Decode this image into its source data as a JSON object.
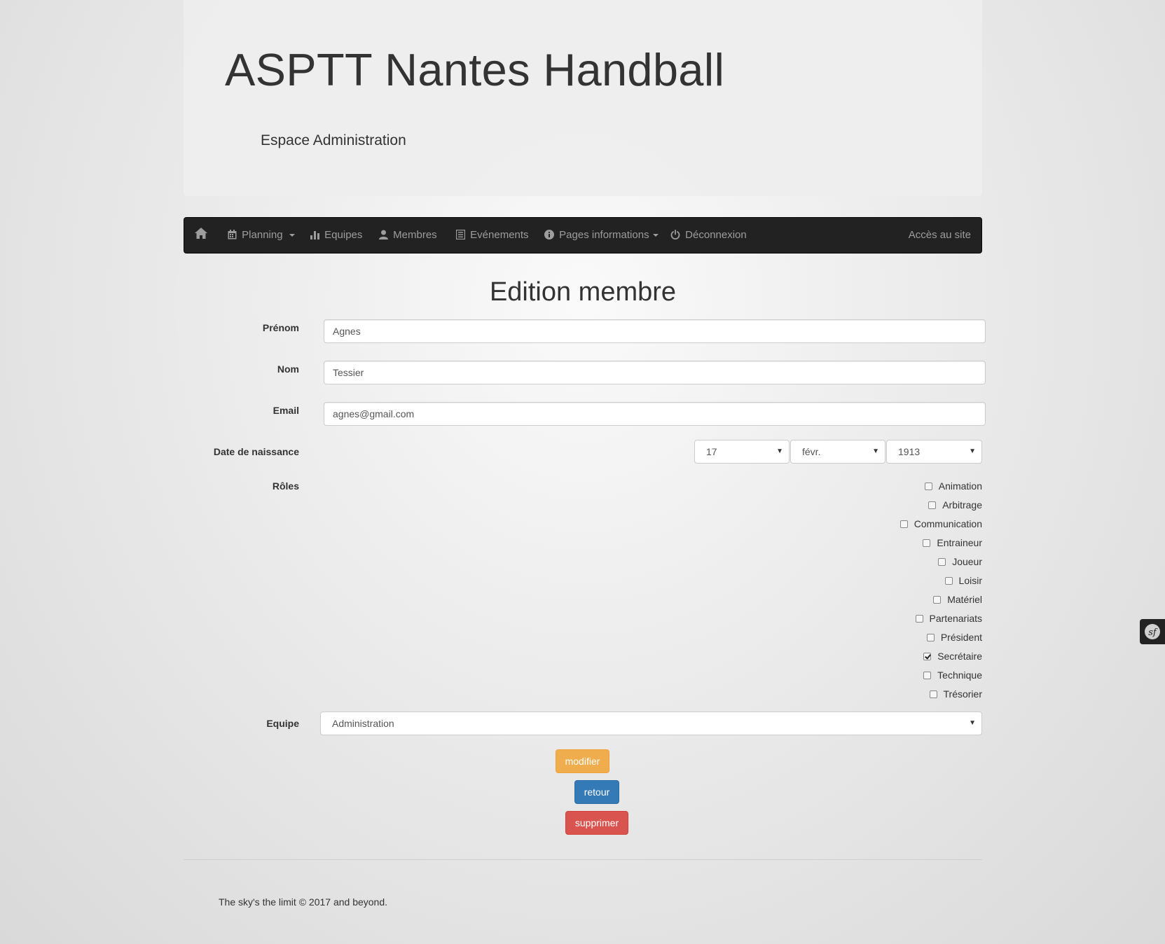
{
  "header": {
    "title": "ASPTT Nantes Handball",
    "subtitle": "Espace Administration"
  },
  "navbar": {
    "home_icon": "home-icon",
    "items": [
      {
        "label": "Planning",
        "icon": "calendar-icon",
        "dropdown": true
      },
      {
        "label": "Equipes",
        "icon": "stats-icon",
        "dropdown": false
      },
      {
        "label": "Membres",
        "icon": "user-icon",
        "dropdown": false
      },
      {
        "label": "Evénements",
        "icon": "list-icon",
        "dropdown": false
      },
      {
        "label": "Pages informations",
        "icon": "info-icon",
        "dropdown": true
      },
      {
        "label": "Déconnexion",
        "icon": "power-icon",
        "dropdown": false
      }
    ],
    "right_link": "Accès au site",
    "background": "#222222",
    "text_color": "#9d9d9d"
  },
  "page_title": "Edition membre",
  "form": {
    "prenom": {
      "label": "Prénom",
      "value": "Agnes"
    },
    "nom": {
      "label": "Nom",
      "value": "Tessier"
    },
    "email": {
      "label": "Email",
      "value": "agnes@gmail.com"
    },
    "birthdate": {
      "label": "Date de naissance",
      "day": "17",
      "month": "févr.",
      "year": "1913"
    },
    "roles": {
      "label": "Rôles",
      "items": [
        {
          "label": "Animation",
          "checked": false
        },
        {
          "label": "Arbitrage",
          "checked": false
        },
        {
          "label": "Communication",
          "checked": false
        },
        {
          "label": "Entraineur",
          "checked": false
        },
        {
          "label": "Joueur",
          "checked": false
        },
        {
          "label": "Loisir",
          "checked": false
        },
        {
          "label": "Matériel",
          "checked": false
        },
        {
          "label": "Partenariats",
          "checked": false
        },
        {
          "label": "Président",
          "checked": false
        },
        {
          "label": "Secrétaire",
          "checked": true
        },
        {
          "label": "Technique",
          "checked": false
        },
        {
          "label": "Trésorier",
          "checked": false
        }
      ]
    },
    "equipe": {
      "label": "Equipe",
      "value": "Administration"
    }
  },
  "buttons": {
    "modifier": "modifier",
    "retour": "retour",
    "supprimer": "supprimer",
    "colors": {
      "warning": "#f0ad4e",
      "primary": "#337ab7",
      "danger": "#d9534f"
    }
  },
  "footer": {
    "text": "The sky's the limit © 2017 and beyond."
  },
  "debug_toolbar": {
    "icon": "symfony-icon"
  }
}
